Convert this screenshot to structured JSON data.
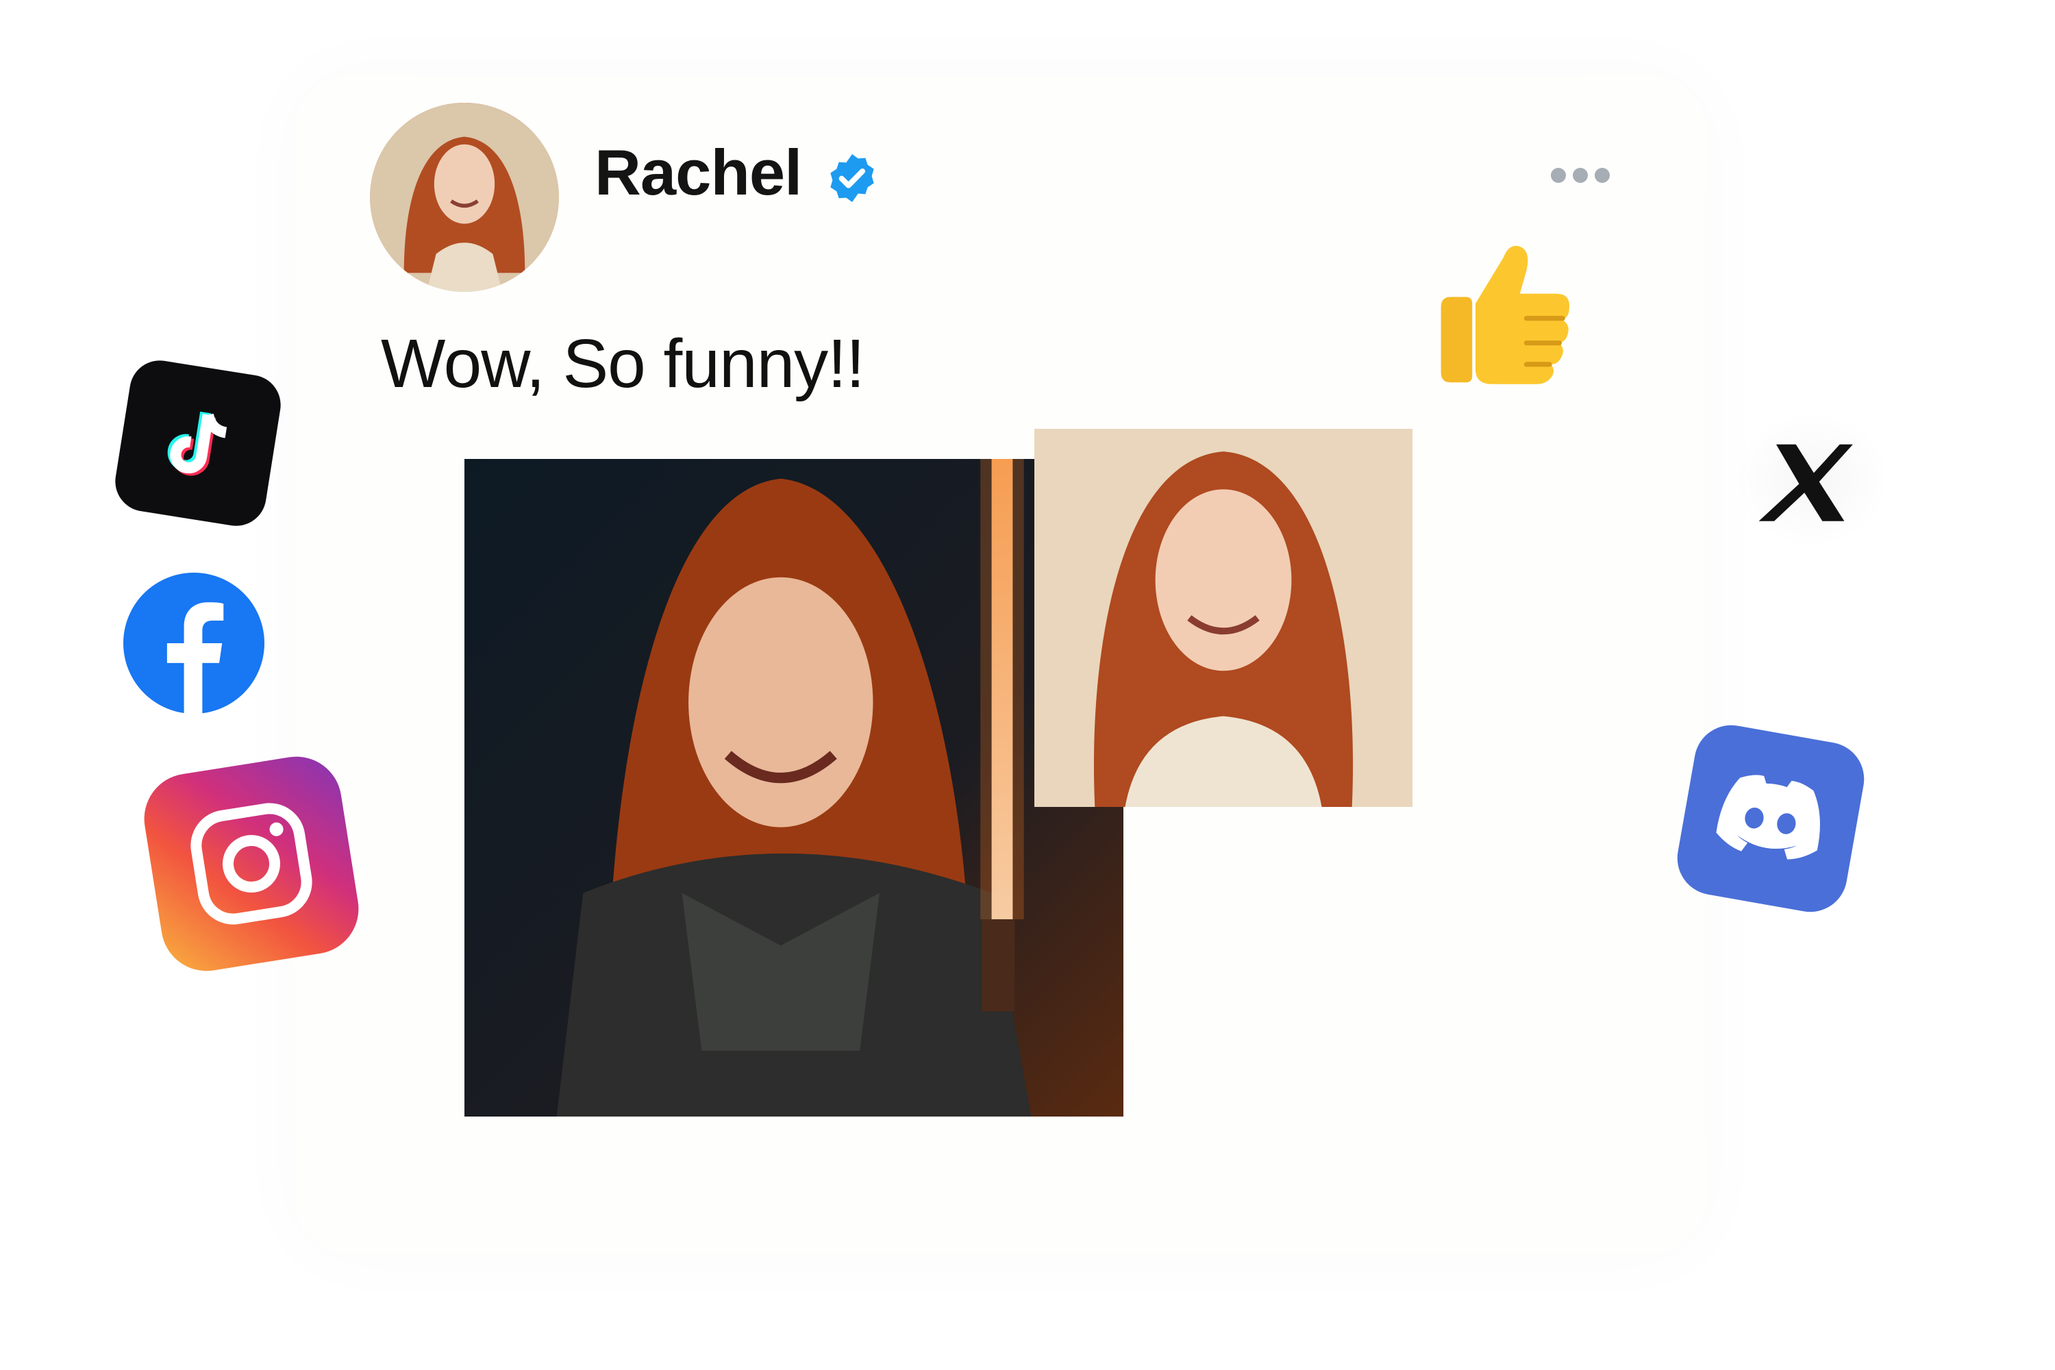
{
  "post": {
    "username": "Rachel",
    "verified": true,
    "text": "Wow, So funny!!"
  },
  "icons": {
    "verified": "verified-badge-icon",
    "more": "more-options-icon",
    "reaction": "thumbs-up-icon"
  },
  "social_icons": [
    "tiktok",
    "facebook",
    "instagram",
    "x",
    "discord"
  ],
  "images": {
    "avatar": "avatar photo",
    "armor_photo": "illustrated portrait in armor with lightsaber",
    "portrait_photo": "smiling portrait photo"
  },
  "colors": {
    "verified_badge": "#1d9bf0",
    "facebook": "#1877f2",
    "discord": "#4a6fd8",
    "tiktok_bg": "#0d0d0f"
  }
}
